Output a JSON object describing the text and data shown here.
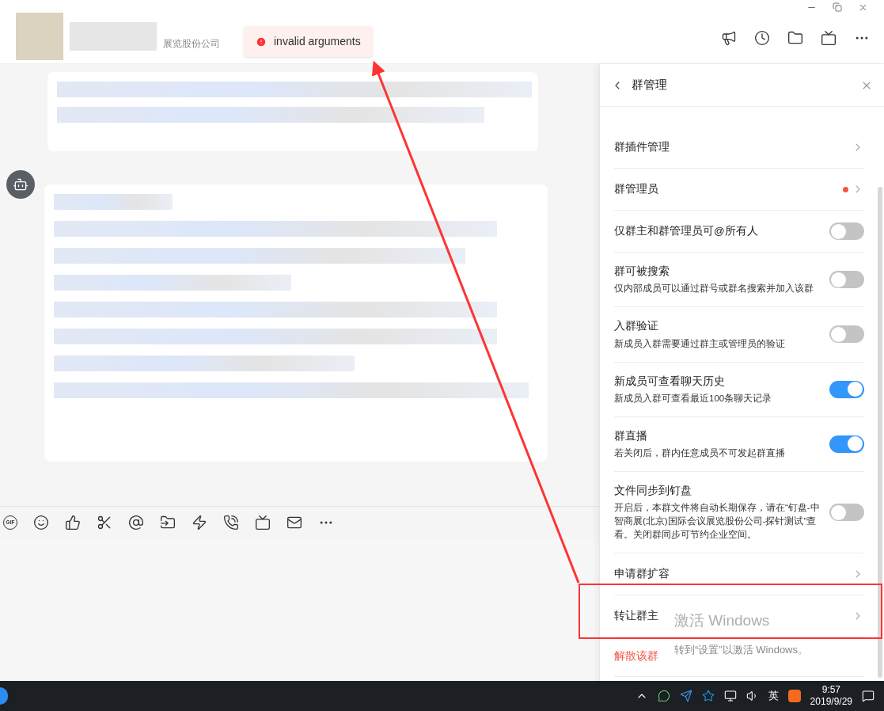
{
  "header": {
    "company": "展览股份公司"
  },
  "toast": {
    "text": "invalid arguments"
  },
  "composer": {
    "gif_label": "GIF"
  },
  "panel": {
    "title": "群管理",
    "items": [
      {
        "kind": "link",
        "title": "群插件管理",
        "dot": false
      },
      {
        "kind": "link",
        "title": "群管理员",
        "dot": true
      },
      {
        "kind": "toggle",
        "title": "仅群主和群管理员可@所有人",
        "on": false
      },
      {
        "kind": "toggle",
        "title": "群可被搜索",
        "desc": "仅内部成员可以通过群号或群名搜索并加入该群",
        "on": false
      },
      {
        "kind": "toggle",
        "title": "入群验证",
        "desc": "新成员入群需要通过群主或管理员的验证",
        "on": false
      },
      {
        "kind": "toggle",
        "title": "新成员可查看聊天历史",
        "desc": "新成员入群可查看最近100条聊天记录",
        "on": true
      },
      {
        "kind": "toggle",
        "title": "群直播",
        "desc": "若关闭后，群内任意成员不可发起群直播",
        "on": true
      },
      {
        "kind": "toggle",
        "title": "文件同步到钉盘",
        "desc": "开启后，本群文件将自动长期保存，请在“钉盘-中智商展(北京)国际会议展览股份公司-探针测试”查看。关闭群同步可节约企业空间。",
        "on": false
      },
      {
        "kind": "link",
        "title": "申请群扩容",
        "dot": false
      },
      {
        "kind": "link",
        "title": "转让群主",
        "dot": false
      },
      {
        "kind": "danger",
        "title": "解散该群"
      }
    ]
  },
  "activation": {
    "title": "激活 Windows",
    "subtitle": "转到“设置”以激活 Windows。"
  },
  "taskbar": {
    "ime": "英",
    "time": "9:57",
    "date": "2019/9/29"
  }
}
